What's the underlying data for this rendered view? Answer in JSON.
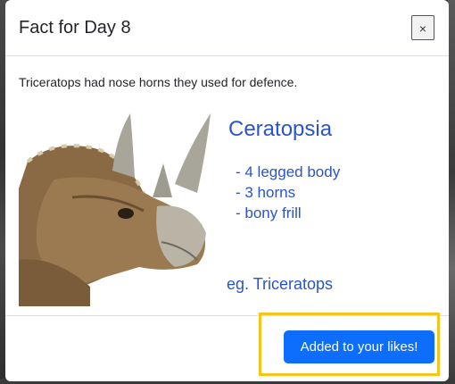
{
  "modal": {
    "title": "Fact for Day 8",
    "close_label": "×",
    "fact_text": "Triceratops had nose horns they used for defence.",
    "image": {
      "heading": "Ceratopsia",
      "items": [
        "- 4 legged body",
        "- 3 horns",
        "- bony frill"
      ],
      "example": "eg. Triceratops"
    },
    "like_button_label": "Added to your likes!"
  },
  "colors": {
    "primary_button": "#0d6efd",
    "image_text": "#2a55c8",
    "highlight": "#f5c518"
  }
}
